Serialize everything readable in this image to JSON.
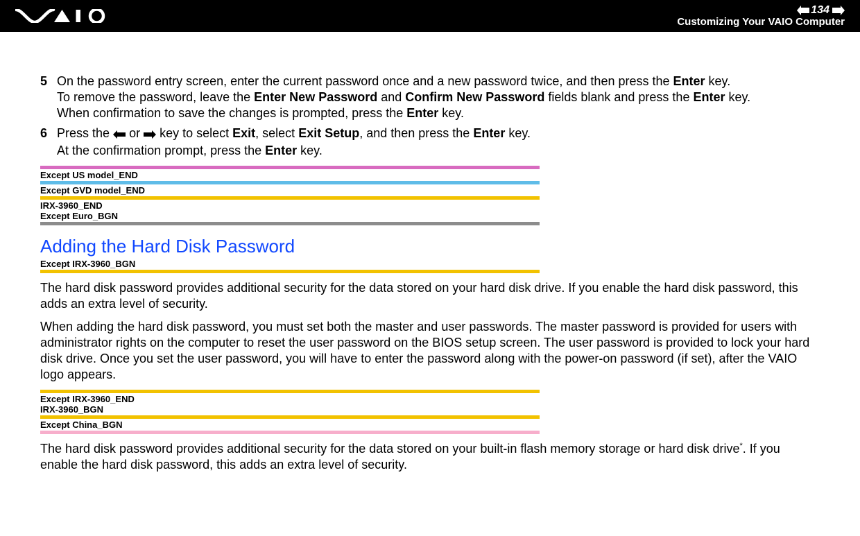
{
  "header": {
    "page_number": "134",
    "n_label": "",
    "section_title": "Customizing Your VAIO Computer"
  },
  "steps": {
    "s5": {
      "num": "5",
      "line1a": "On the password entry screen, enter the current password once and a new password twice, and then press the ",
      "enter1": "Enter",
      "line1b": " key.",
      "line2a": "To remove the password, leave the ",
      "enp": "Enter New Password",
      "line2b": " and ",
      "cnp": "Confirm New Password",
      "line2c": " fields blank and press the ",
      "enter2": "Enter",
      "line2d": " key.",
      "line3a": "When confirmation to save the changes is prompted, press the ",
      "enter3": "Enter",
      "line3b": " key."
    },
    "s6": {
      "num": "6",
      "a": "Press the ",
      "b": " or ",
      "c": " key to select ",
      "exit": "Exit",
      "d": ", select ",
      "exitsetup": "Exit Setup",
      "e": ", and then press the ",
      "enter1": "Enter",
      "f": " key.",
      "g": "At the confirmation prompt, press the ",
      "enter2": "Enter",
      "h": " key."
    }
  },
  "markers1": {
    "m1": "Except US model_END",
    "m2": "Except GVD model_END",
    "m3": "IRX-3960_END",
    "m4": "Except Euro_BGN"
  },
  "subheading": "Adding the Hard Disk Password",
  "markers2": {
    "m1": "Except IRX-3960_BGN"
  },
  "para1": "The hard disk password provides additional security for the data stored on your hard disk drive. If you enable the hard disk password, this adds an extra level of security.",
  "para2": "When adding the hard disk password, you must set both the master and user passwords. The master password is provided for users with administrator rights on the computer to reset the user password on the BIOS setup screen. The user password is provided to lock your hard disk drive. Once you set the user password, you will have to enter the password along with the power-on password (if set), after the VAIO logo appears.",
  "markers3": {
    "m1": "Except IRX-3960_END",
    "m2": "IRX-3960_BGN",
    "m3": "Except China_BGN"
  },
  "para3a": "The hard disk password provides additional security for the data stored on your built-in flash memory storage or hard disk drive",
  "para3sup": "*",
  "para3b": ". If you enable the hard disk password, this adds an extra level of security."
}
